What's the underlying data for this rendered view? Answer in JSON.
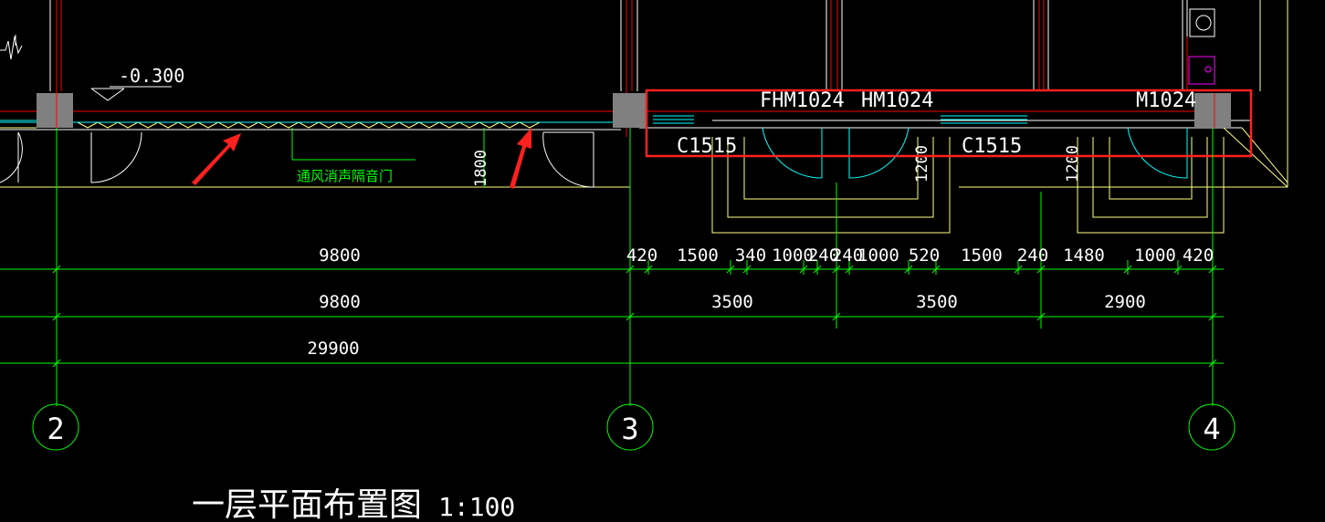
{
  "drawing": {
    "title": "一层平面布置图",
    "scale": "1:100",
    "elevation": "-0.300",
    "vent_door_label": "通风消声隔音门",
    "vertical_dim": "1800",
    "labels": {
      "fhm": "FHM1024",
      "hm": "HM1024",
      "m": "M1024",
      "c_left": "C1515",
      "c_right": "C1515",
      "dim_1200_a": "1200",
      "dim_1200_b": "1200"
    },
    "row1": [
      "9800",
      "420",
      "1500",
      "340",
      "1000",
      "240",
      "240",
      "1000",
      "520",
      "1500",
      "240",
      "1480",
      "1000",
      "420"
    ],
    "row2": [
      "9800",
      "3500",
      "3500",
      "2900"
    ],
    "row3": "29900",
    "axes": [
      "2",
      "3",
      "4"
    ],
    "colors": {
      "background": "#000000",
      "dimension_line": "#00ff00",
      "axis_red": "#ff0000",
      "wall_white": "#ffffff",
      "window_cyan": "#00ffff",
      "wall_yellow": "#ffff80",
      "annotation_green": "#00ff00",
      "highlight_red": "#ff2020",
      "column_gray": "#808080",
      "magenta": "#ff00ff"
    }
  }
}
